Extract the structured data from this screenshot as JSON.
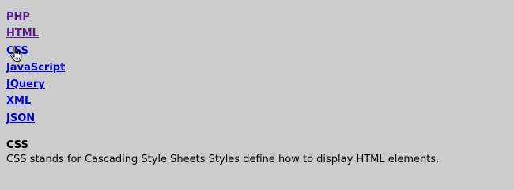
{
  "nav": {
    "items": [
      {
        "label": "PHP",
        "visited": true
      },
      {
        "label": "HTML",
        "visited": true
      },
      {
        "label": "CSS",
        "visited": false
      },
      {
        "label": "JavaScript",
        "visited": false
      },
      {
        "label": "JQuery",
        "visited": false
      },
      {
        "label": "XML",
        "visited": false
      },
      {
        "label": "JSON",
        "visited": false
      }
    ]
  },
  "detail": {
    "title": "CSS",
    "text": "CSS stands for Cascading Style Sheets Styles define how to display HTML elements."
  },
  "colors": {
    "background": "#cccccc",
    "link": "#0000cc",
    "visited_link": "#551a8b",
    "text": "#000000"
  },
  "cursor": {
    "icon": "hand-pointer-icon"
  }
}
